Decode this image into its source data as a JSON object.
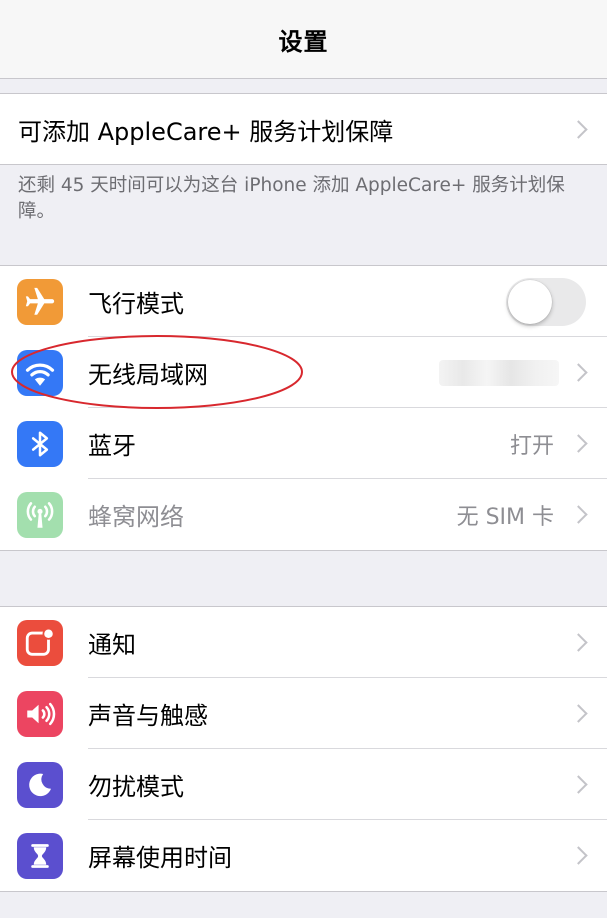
{
  "nav": {
    "title": "设置"
  },
  "applecare": {
    "label": "可添加 AppleCare+ 服务计划保障",
    "footnote": "还剩 45 天时间可以为这台 iPhone 添加 AppleCare+ 服务计划保障。"
  },
  "connectivity": {
    "airplane": {
      "label": "飞行模式",
      "icon": "airplane-icon",
      "color": "#f19a37",
      "toggle_on": false
    },
    "wifi": {
      "label": "无线局域网",
      "icon": "wifi-icon",
      "color": "#3478f6"
    },
    "bluetooth": {
      "label": "蓝牙",
      "value": "打开",
      "icon": "bluetooth-icon",
      "color": "#3478f6"
    },
    "cellular": {
      "label": "蜂窝网络",
      "value": "无 SIM 卡",
      "icon": "cellular-antenna-icon",
      "color": "#a3dfae"
    }
  },
  "general": {
    "notifications": {
      "label": "通知",
      "icon": "notifications-icon",
      "color": "#eb4d3d"
    },
    "sounds": {
      "label": "声音与触感",
      "icon": "speaker-icon",
      "color": "#ec4561"
    },
    "dnd": {
      "label": "勿扰模式",
      "icon": "moon-icon",
      "color": "#5b4fcf"
    },
    "screen_time": {
      "label": "屏幕使用时间",
      "icon": "hourglass-icon",
      "color": "#5b4fcf"
    }
  },
  "annotation": {
    "color": "#d8282e"
  }
}
